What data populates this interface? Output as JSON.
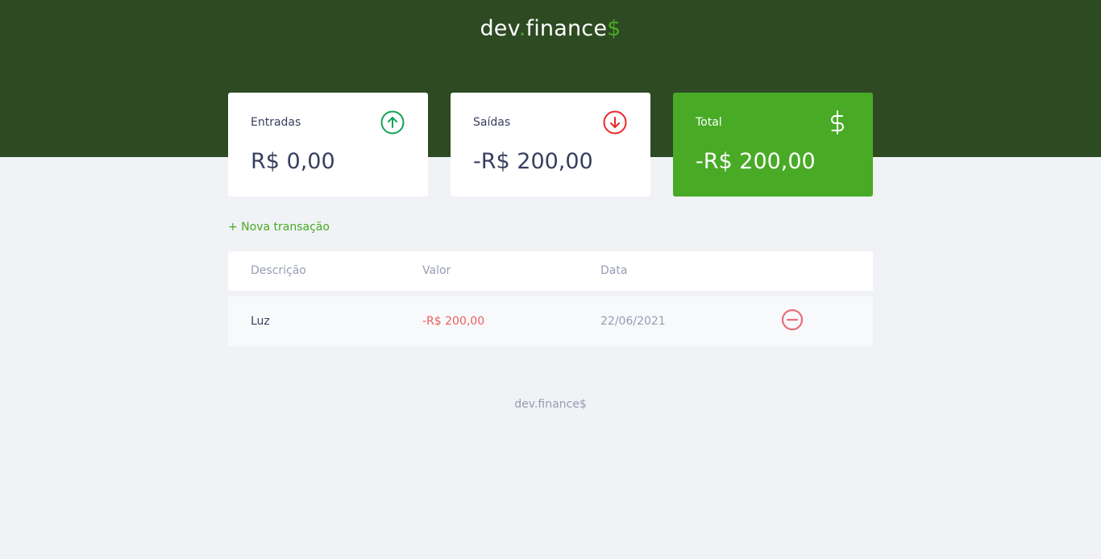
{
  "header": {
    "logo_part1": "dev",
    "logo_dot": ".",
    "logo_part2": "finance",
    "logo_dollar": "$"
  },
  "balance": {
    "income": {
      "label": "Entradas",
      "value": "R$ 0,00",
      "icon": "arrow-up-circle-icon",
      "color": "#12a454"
    },
    "expense": {
      "label": "Saídas",
      "value": "-R$ 200,00",
      "icon": "arrow-down-circle-icon",
      "color": "#e92929"
    },
    "total": {
      "label": "Total",
      "value": "-R$ 200,00",
      "icon": "dollar-sign-icon",
      "color": "#49aa26"
    }
  },
  "actions": {
    "new_transaction_label": "+ Nova transação"
  },
  "table": {
    "columns": [
      "Descrição",
      "Valor",
      "Data"
    ],
    "rows": [
      {
        "description": "Luz",
        "amount": "-R$ 200,00",
        "date": "22/06/2021"
      }
    ]
  },
  "footer": {
    "text": "dev.finance$"
  },
  "colors": {
    "header_bg": "#2d4a22",
    "accent": "#49aa26",
    "page_bg": "#f0f2f5",
    "text": "#363f5f",
    "muted": "#969cb3",
    "negative": "#e92929"
  }
}
